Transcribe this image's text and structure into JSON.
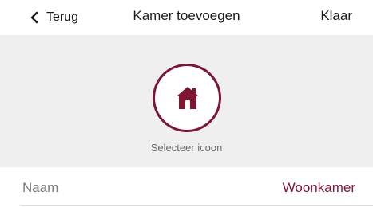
{
  "navbar": {
    "back_label": "Terug",
    "title": "Kamer toevoegen",
    "done_label": "Klaar"
  },
  "icon_picker": {
    "icon": "house-icon",
    "caption": "Selecteer icoon"
  },
  "name_row": {
    "label": "Naam",
    "value": "Woonkamer"
  },
  "colors": {
    "accent": "#7d1533",
    "picker_background": "#efefef",
    "text": "#1a1a1a",
    "muted_text": "#7a7a7a"
  }
}
